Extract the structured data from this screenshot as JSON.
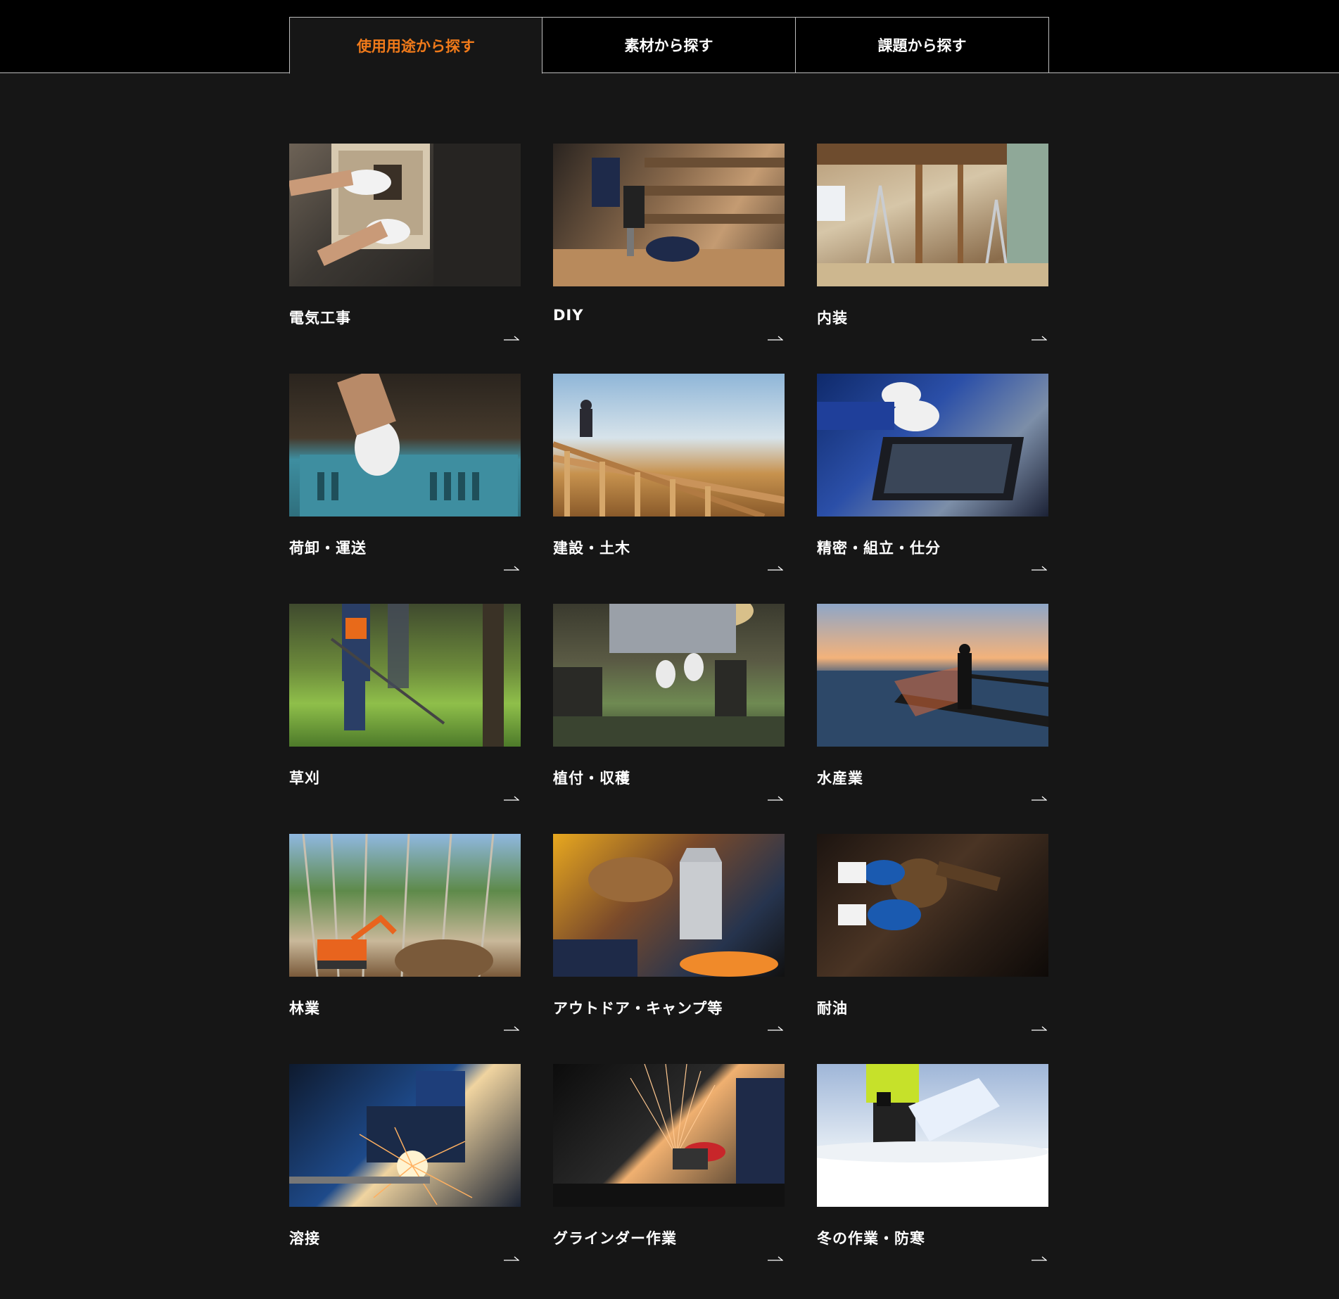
{
  "tabs": [
    {
      "label": "使用用途から探す",
      "active": true
    },
    {
      "label": "素材から探す",
      "active": false
    },
    {
      "label": "課題から探す",
      "active": false
    }
  ],
  "accent_color": "#f07a1a",
  "categories": [
    {
      "title": "電気工事",
      "photo": "electrical-work"
    },
    {
      "title": "DIY",
      "photo": "diy"
    },
    {
      "title": "内装",
      "photo": "interior"
    },
    {
      "title": "荷卸・運送",
      "photo": "unloading-transport"
    },
    {
      "title": "建設・土木",
      "photo": "construction"
    },
    {
      "title": "精密・組立・仕分",
      "photo": "precision-assembly"
    },
    {
      "title": "草刈",
      "photo": "grass-cutting"
    },
    {
      "title": "植付・収穫",
      "photo": "planting-harvest"
    },
    {
      "title": "水産業",
      "photo": "fishery"
    },
    {
      "title": "林業",
      "photo": "forestry"
    },
    {
      "title": "アウトドア・キャンプ等",
      "photo": "outdoor-camp"
    },
    {
      "title": "耐油",
      "photo": "oil-resistant"
    },
    {
      "title": "溶接",
      "photo": "welding"
    },
    {
      "title": "グラインダー作業",
      "photo": "grinder-work"
    },
    {
      "title": "冬の作業・防寒",
      "photo": "winter-work"
    }
  ],
  "arrow_icon": "right-arrow-icon"
}
